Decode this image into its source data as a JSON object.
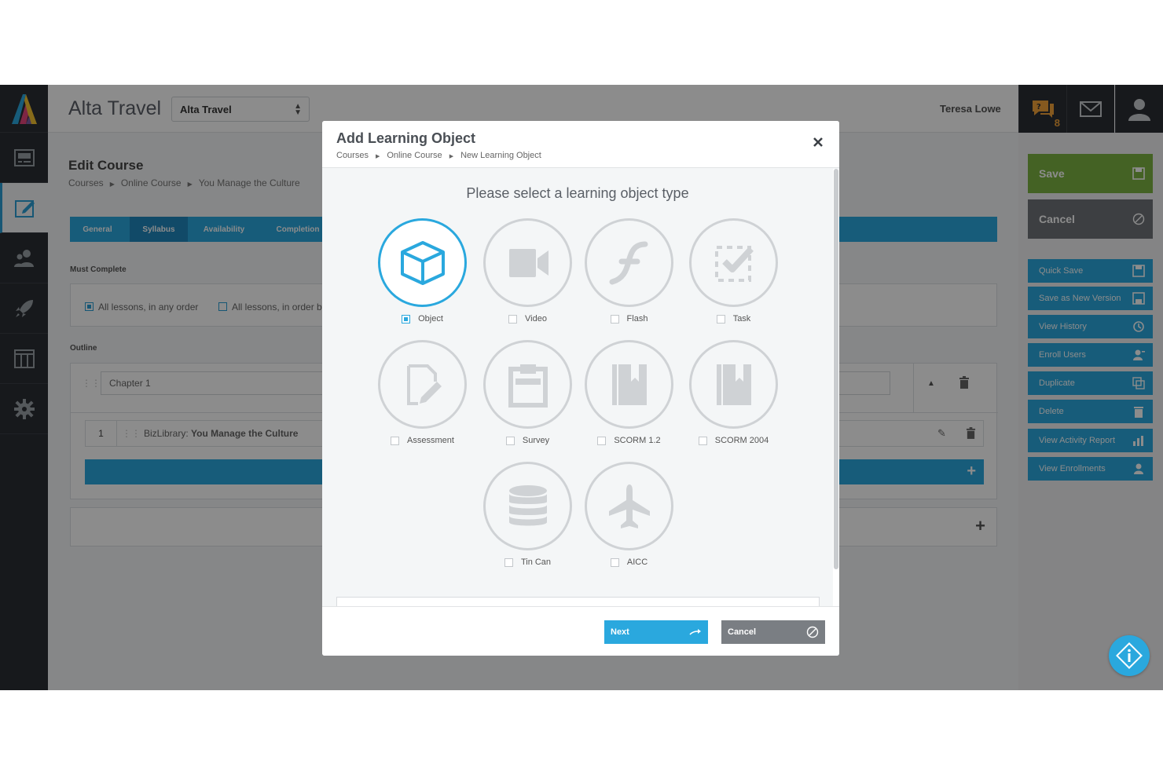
{
  "header": {
    "app_title": "Alta Travel",
    "org_select": "Alta Travel",
    "user_name": "Teresa Lowe",
    "chat_badge": "8"
  },
  "page": {
    "title": "Edit Course",
    "breadcrumb": [
      "Courses",
      "Online Course",
      "You Manage the Culture"
    ],
    "tabs": [
      "General",
      "Syllabus",
      "Availability",
      "Completion"
    ],
    "must_complete_label": "Must Complete",
    "options": [
      "All lessons, in any order",
      "All lessons, in order by"
    ],
    "outline_label": "Outline",
    "chapter_title": "Chapter 1",
    "lesson": {
      "number": "1",
      "prefix": "BizLibrary:",
      "title": "You Manage the Culture"
    }
  },
  "rightrail": {
    "save": "Save",
    "cancel": "Cancel",
    "actions": [
      "Quick Save",
      "Save as New Version",
      "View History",
      "Enroll Users",
      "Duplicate",
      "Delete",
      "View Activity Report",
      "View Enrollments"
    ]
  },
  "modal": {
    "title": "Add Learning Object",
    "breadcrumb": [
      "Courses",
      "Online Course",
      "New Learning Object"
    ],
    "prompt": "Please select a learning object type",
    "types": [
      {
        "label": "Object",
        "icon": "cube-icon",
        "selected": true
      },
      {
        "label": "Video",
        "icon": "video-camera-icon",
        "selected": false
      },
      {
        "label": "Flash",
        "icon": "flash-icon",
        "selected": false
      },
      {
        "label": "Task",
        "icon": "task-check-icon",
        "selected": false
      },
      {
        "label": "Assessment",
        "icon": "assessment-edit-icon",
        "selected": false
      },
      {
        "label": "Survey",
        "icon": "clipboard-icon",
        "selected": false
      },
      {
        "label": "SCORM 1.2",
        "icon": "book-icon",
        "selected": false
      },
      {
        "label": "SCORM 2004",
        "icon": "book-icon",
        "selected": false
      },
      {
        "label": "Tin Can",
        "icon": "database-icon",
        "selected": false
      },
      {
        "label": "AICC",
        "icon": "airplane-icon",
        "selected": false
      }
    ],
    "next": "Next",
    "cancel": "Cancel"
  },
  "colors": {
    "accent": "#2aa8de",
    "save_green": "#7cb342",
    "cancel_gray": "#7a7e83",
    "nav_dark": "#2b2e33"
  }
}
